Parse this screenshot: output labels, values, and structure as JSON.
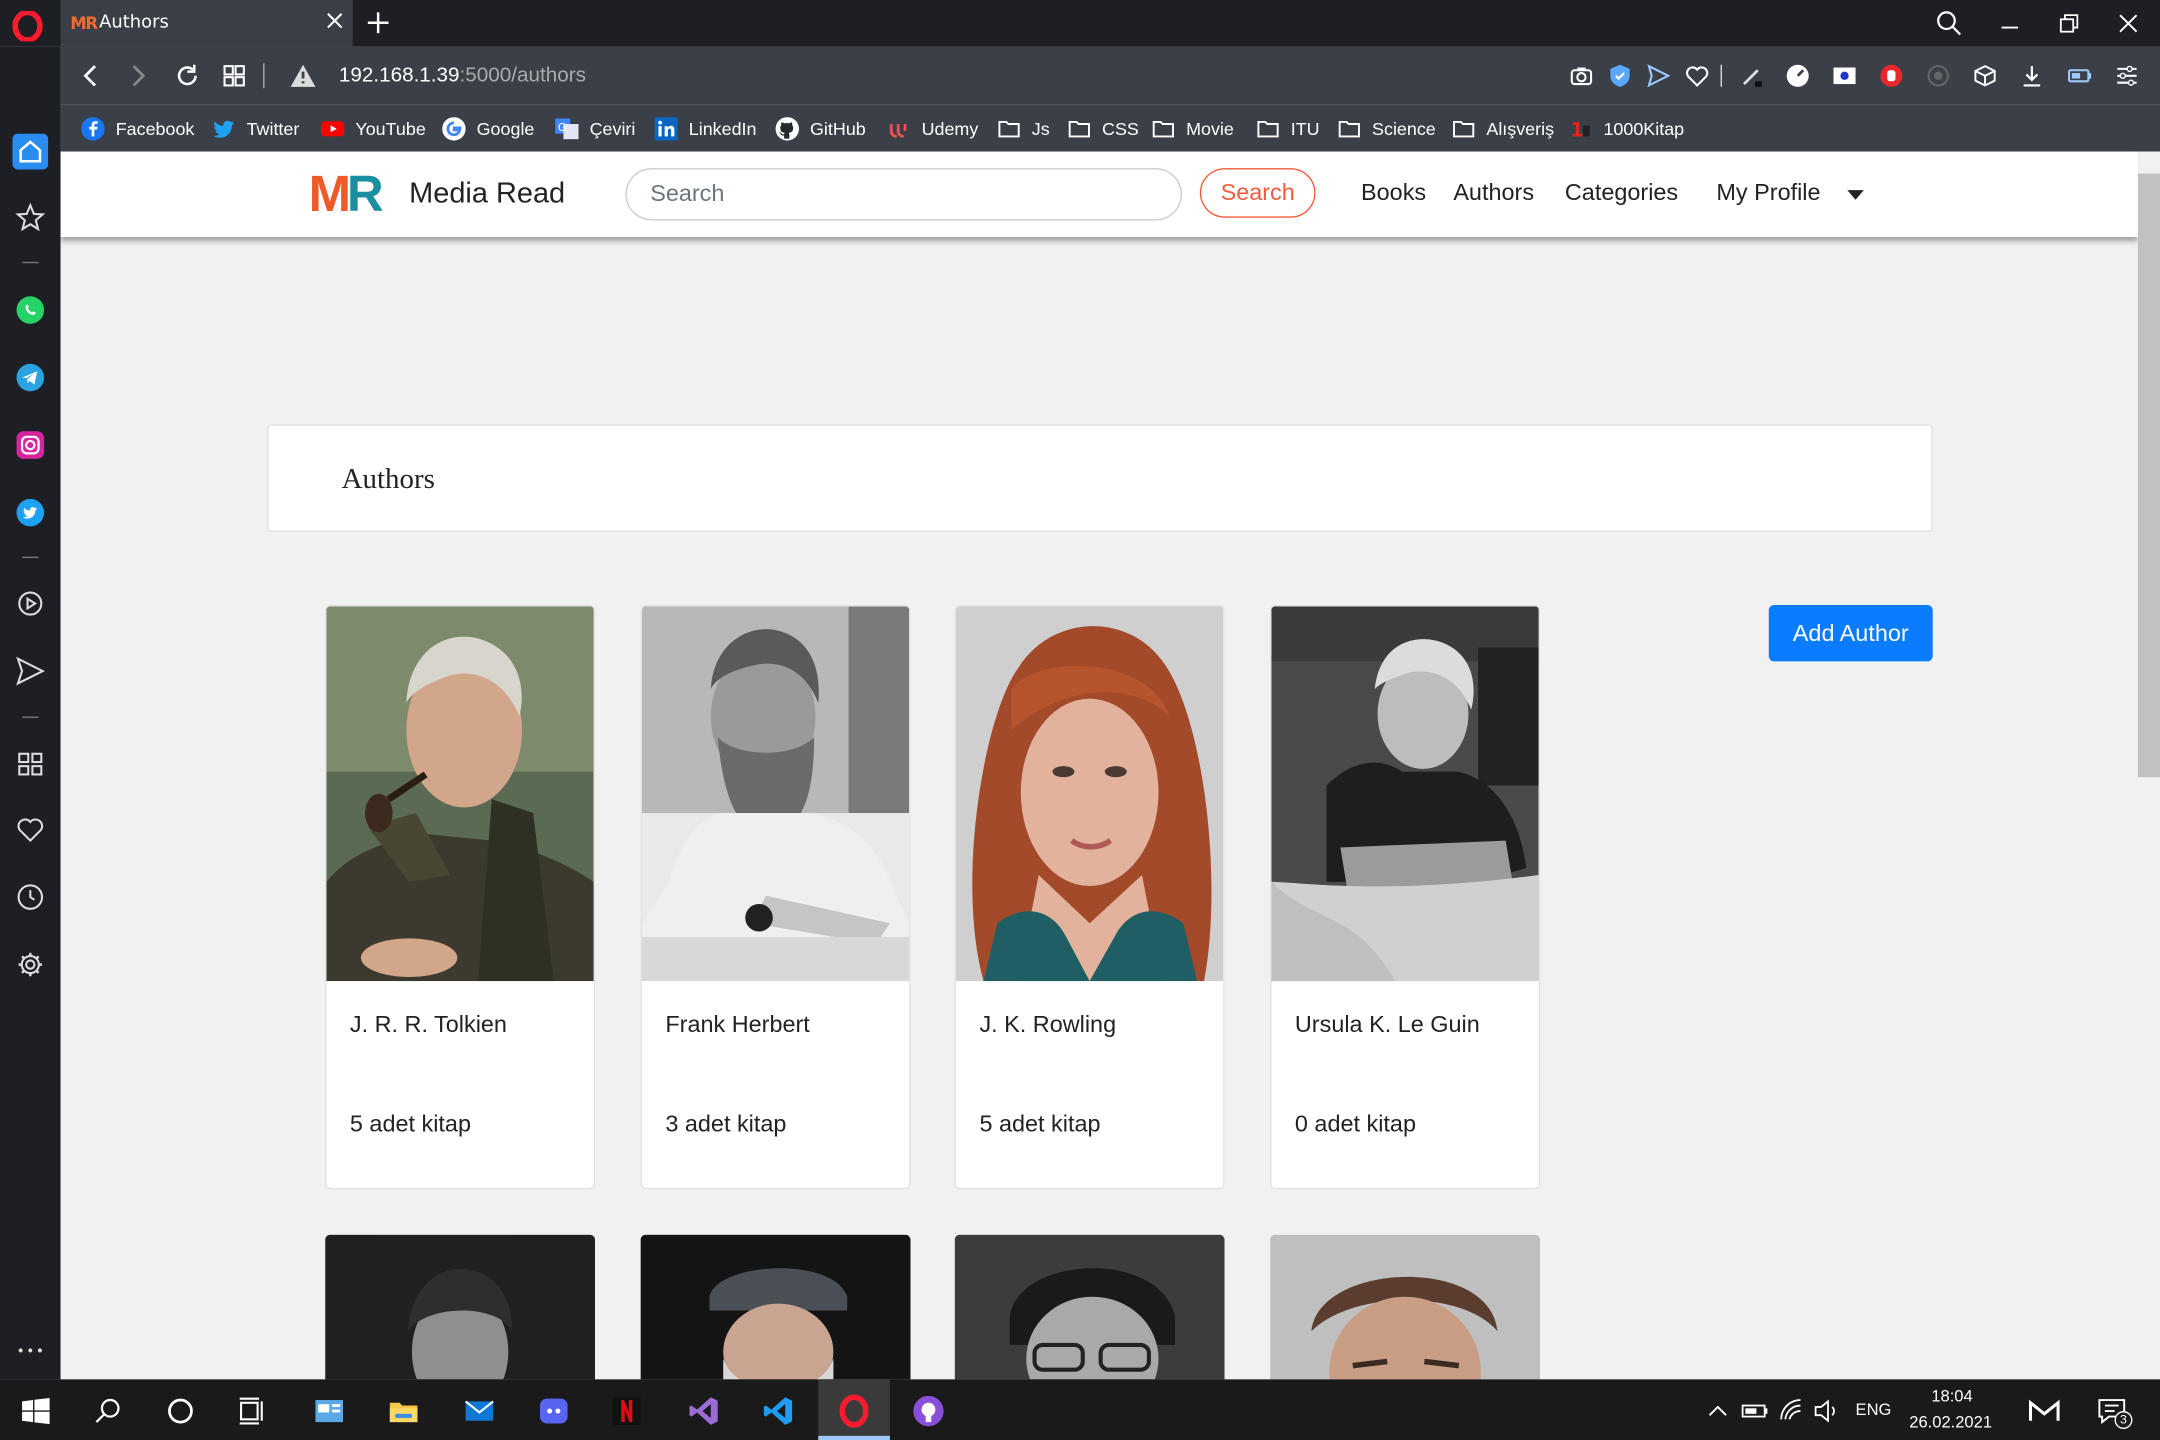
{
  "browser": {
    "tab_title": "Authors",
    "tab_favicon_text": "MR",
    "url_host": "192.168.1.39",
    "url_path": ":5000/authors",
    "bookmarks": [
      {
        "label": "Facebook",
        "icon": "facebook-icon"
      },
      {
        "label": "Twitter",
        "icon": "twitter-icon"
      },
      {
        "label": "YouTube",
        "icon": "youtube-icon"
      },
      {
        "label": "Google",
        "icon": "google-icon"
      },
      {
        "label": "Çeviri",
        "icon": "translate-icon"
      },
      {
        "label": "LinkedIn",
        "icon": "linkedin-icon"
      },
      {
        "label": "GitHub",
        "icon": "github-icon"
      },
      {
        "label": "Udemy",
        "icon": "udemy-icon"
      },
      {
        "label": "Js",
        "icon": "folder-icon"
      },
      {
        "label": "CSS",
        "icon": "folder-icon"
      },
      {
        "label": "Movie",
        "icon": "folder-icon"
      },
      {
        "label": "ITU",
        "icon": "folder-icon"
      },
      {
        "label": "Science",
        "icon": "folder-icon"
      },
      {
        "label": "Alışveriş",
        "icon": "folder-icon"
      },
      {
        "label": "1000Kitap",
        "icon": "1000kitap-icon"
      }
    ]
  },
  "site": {
    "brand_logo_m": "M",
    "brand_logo_r": "R",
    "brand_name": "Media Read",
    "search_placeholder": "Search",
    "search_button": "Search",
    "nav": {
      "books": "Books",
      "authors": "Authors",
      "categories": "Categories",
      "profile": "My Profile"
    }
  },
  "main": {
    "heading": "Authors",
    "add_button": "Add Author",
    "authors": [
      {
        "name": "J. R. R. Tolkien",
        "books": "5 adet kitap"
      },
      {
        "name": "Frank Herbert",
        "books": "3 adet kitap"
      },
      {
        "name": "J. K. Rowling",
        "books": "5 adet kitap"
      },
      {
        "name": "Ursula K. Le Guin",
        "books": "0 adet kitap"
      }
    ]
  },
  "taskbar": {
    "language": "ENG",
    "time": "18:04",
    "date": "26.02.2021",
    "notifications": "3"
  },
  "colors": {
    "brand_orange": "#ef5a28",
    "brand_teal": "#1a8fa0",
    "search_accent": "#f25c3c",
    "primary_button": "#0a7cff",
    "browser_chrome": "#3b4048"
  }
}
